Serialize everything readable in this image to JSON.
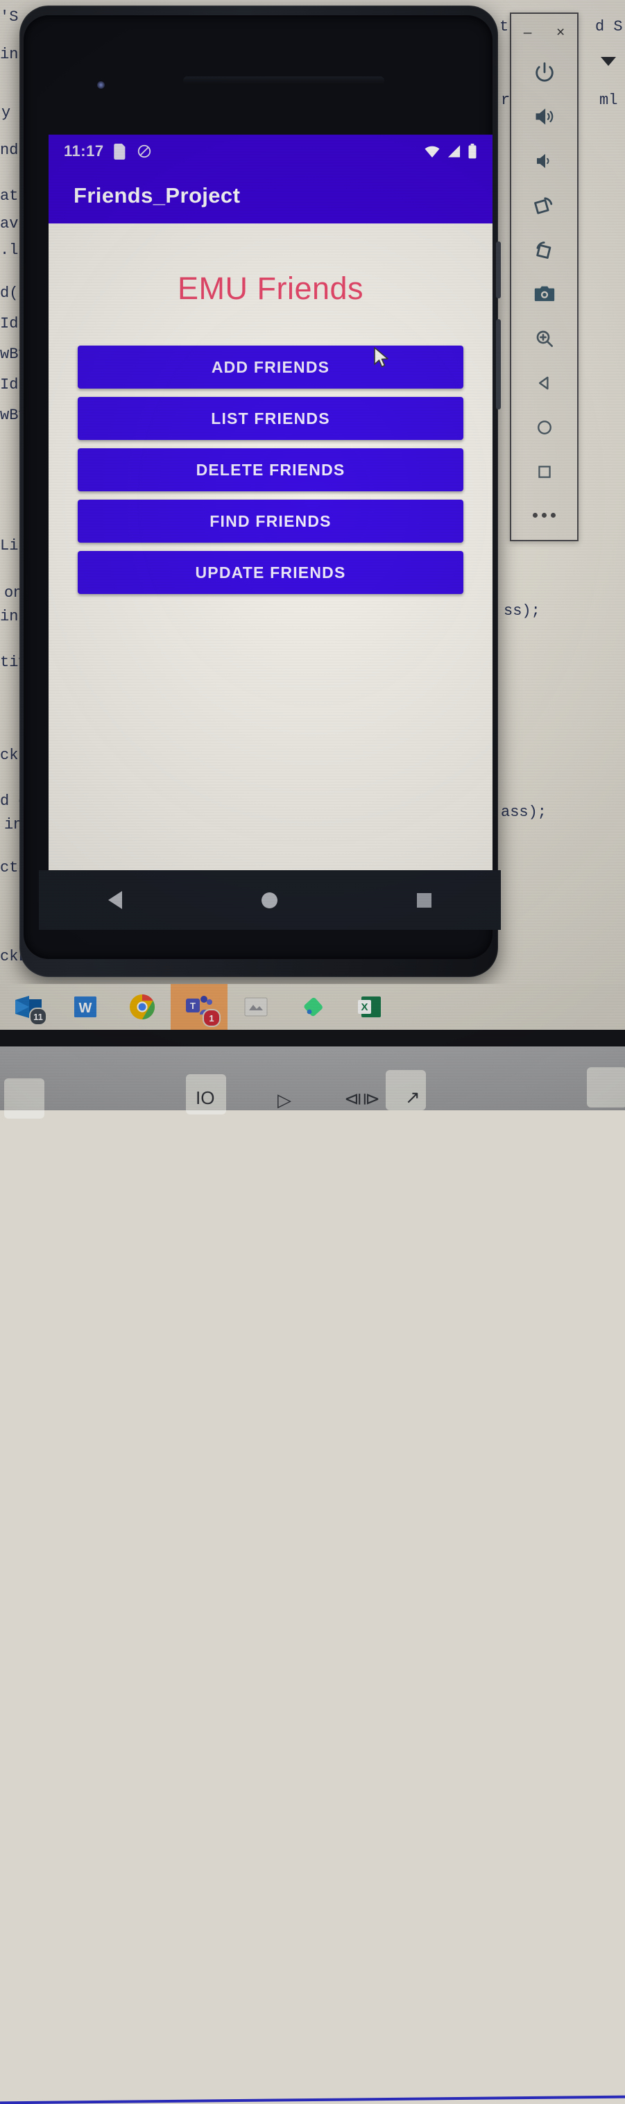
{
  "photo": {
    "description": "Photograph of a laptop screen showing an Android emulator running the Friends_Project app"
  },
  "ide_background": {
    "left_fragments": [
      "'S  W",
      "in",
      "y",
      "nd",
      "at",
      "av",
      ".l",
      "d(",
      "Id",
      "wBy",
      "Id",
      "wBy",
      "Lis",
      "on",
      "int",
      "tiv",
      "ckLi",
      "d on",
      "int",
      "ctiv",
      "ckLi"
    ],
    "right_fragments": [
      "t ap",
      "d S",
      "rit",
      "ml",
      "ss);",
      "ass);"
    ]
  },
  "emulator_toolbar": {
    "minimize_label": "–",
    "close_label": "×",
    "buttons": [
      {
        "name": "power-icon",
        "label": "Power"
      },
      {
        "name": "volume-up-icon",
        "label": "Volume Up"
      },
      {
        "name": "volume-down-icon",
        "label": "Volume Down"
      },
      {
        "name": "rotate-left-icon",
        "label": "Rotate Left"
      },
      {
        "name": "rotate-right-icon",
        "label": "Rotate Right"
      },
      {
        "name": "screenshot-icon",
        "label": "Take Screenshot"
      },
      {
        "name": "zoom-icon",
        "label": "Zoom Mode"
      },
      {
        "name": "back-icon",
        "label": "Back"
      },
      {
        "name": "home-icon",
        "label": "Home"
      },
      {
        "name": "overview-icon",
        "label": "Overview"
      },
      {
        "name": "more-icon",
        "label": "More"
      }
    ]
  },
  "phone": {
    "statusbar": {
      "time": "11:17",
      "left_icons": [
        "sim-card-icon",
        "do-not-disturb-icon"
      ],
      "right_icons": [
        "wifi-icon",
        "cellular-signal-icon",
        "battery-icon"
      ]
    },
    "appbar": {
      "title": "Friends_Project"
    },
    "app": {
      "heading": "EMU Friends",
      "heading_color": "#e8486b",
      "accent_color": "#3a0de0",
      "buttons": [
        {
          "id": "add",
          "label": "ADD FRIENDS"
        },
        {
          "id": "list",
          "label": "LIST FRIENDS"
        },
        {
          "id": "delete",
          "label": "DELETE FRIENDS"
        },
        {
          "id": "find",
          "label": "FIND FRIENDS"
        },
        {
          "id": "update",
          "label": "UPDATE FRIENDS"
        }
      ]
    },
    "navbar": {
      "back": "Back",
      "home": "Home",
      "recents": "Recents"
    }
  },
  "taskbar": {
    "items": [
      {
        "name": "outlook-icon",
        "label": "Outlook",
        "badge": "11",
        "active": false
      },
      {
        "name": "word-icon",
        "label": "Word",
        "badge": "",
        "active": false
      },
      {
        "name": "chrome-icon",
        "label": "Google Chrome",
        "badge": "",
        "active": false
      },
      {
        "name": "teams-icon",
        "label": "Microsoft Teams",
        "badge": "1",
        "active": true
      },
      {
        "name": "notepad-icon",
        "label": "Sticky Notes",
        "badge": "",
        "active": false
      },
      {
        "name": "android-studio-icon",
        "label": "Android Studio",
        "badge": "",
        "active": false
      },
      {
        "name": "excel-icon",
        "label": "Excel",
        "badge": "",
        "active": false
      }
    ]
  },
  "laptop_keys": {
    "keys": [
      "OI",
      "▷",
      "⧏⧐",
      "↗"
    ]
  }
}
